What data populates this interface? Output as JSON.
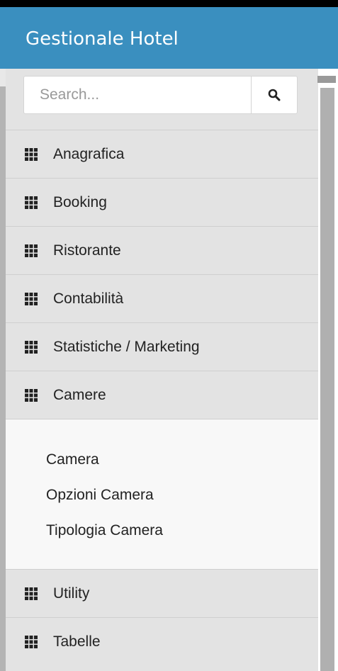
{
  "header": {
    "title": "Gestionale Hotel"
  },
  "search": {
    "placeholder": "Search...",
    "icon": "search-icon"
  },
  "menu": {
    "icon": "grid-icon",
    "items": [
      {
        "label": "Anagrafica"
      },
      {
        "label": "Booking"
      },
      {
        "label": "Ristorante"
      },
      {
        "label": "Contabilità"
      },
      {
        "label": "Statistiche / Marketing"
      },
      {
        "label": "Camere",
        "expanded": true,
        "subitems": [
          {
            "label": "Camera"
          },
          {
            "label": "Opzioni Camera"
          },
          {
            "label": "Tipologia Camera"
          }
        ]
      },
      {
        "label": "Utility"
      },
      {
        "label": "Tabelle"
      }
    ]
  },
  "colors": {
    "header_bg": "#3a8fbf",
    "sidebar_bg": "#e3e3e3",
    "submenu_bg": "#f8f8f8"
  }
}
